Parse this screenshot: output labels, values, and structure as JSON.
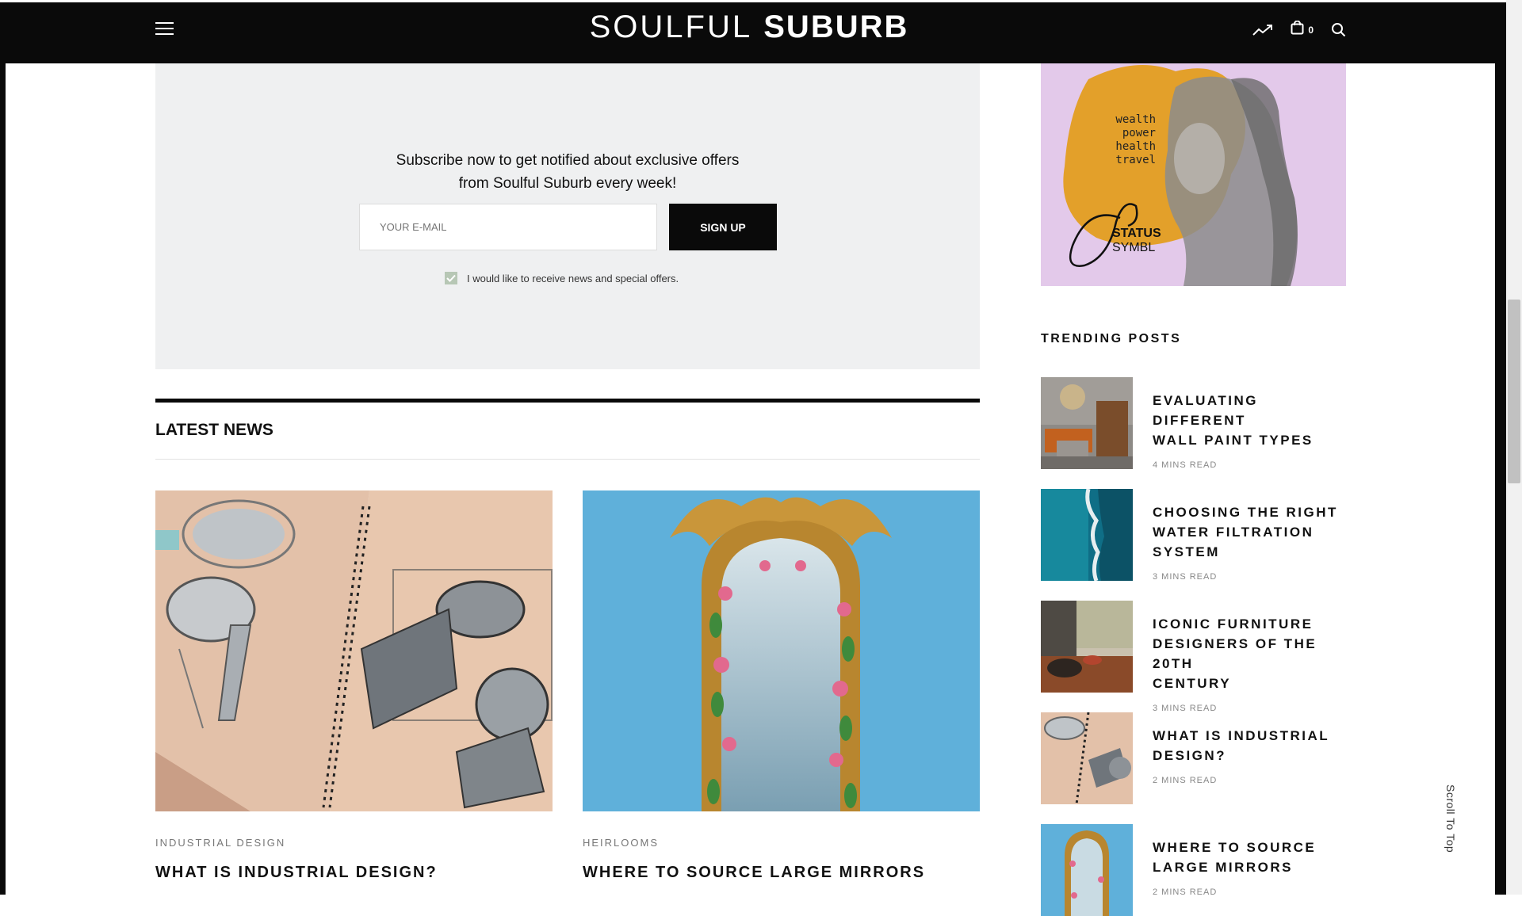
{
  "header": {
    "logo_light": "SOULFUL",
    "logo_bold": "SUBURB",
    "cart_count": "0",
    "icons": [
      "menu-icon",
      "trending-icon",
      "cart-icon",
      "search-icon"
    ]
  },
  "newsletter": {
    "line1": "Subscribe now to get notified about exclusive offers",
    "line2": "from Soulful Suburb every week!",
    "email_placeholder": "YOUR E-MAIL",
    "signup_label": "SIGN UP",
    "consent_label": "I would like to receive news and special offers.",
    "consent_checked": true
  },
  "latest_news": {
    "title": "LATEST NEWS",
    "cards": [
      {
        "category": "INDUSTRIAL DESIGN",
        "title": "WHAT IS INDUSTRIAL DESIGN?"
      },
      {
        "category": "HEIRLOOMS",
        "title": "WHERE TO SOURCE LARGE MIRRORS"
      }
    ]
  },
  "sidebar": {
    "ad": {
      "words": [
        "wealth",
        "power",
        "health",
        "travel"
      ],
      "brand_line1": "STATUS",
      "brand_line2": "SYMBL"
    },
    "trending_title": "TRENDING POSTS",
    "trending": [
      {
        "line1": "EVALUATING DIFFERENT",
        "line2": "WALL PAINT TYPES",
        "line3": "",
        "read": "4 MINS READ"
      },
      {
        "line1": "CHOOSING THE RIGHT",
        "line2": "WATER FILTRATION",
        "line3": "SYSTEM",
        "read": "3 MINS READ"
      },
      {
        "line1": "ICONIC FURNITURE",
        "line2": "DESIGNERS OF THE 20TH",
        "line3": "CENTURY",
        "read": "3 MINS READ"
      },
      {
        "line1": "WHAT IS INDUSTRIAL",
        "line2": "DESIGN?",
        "line3": "",
        "read": "2 MINS READ"
      },
      {
        "line1": "WHERE TO SOURCE",
        "line2": "LARGE MIRRORS",
        "line3": "",
        "read": "2 MINS READ"
      }
    ]
  },
  "scroll_to_top": "Scroll To Top",
  "colors": {
    "topbar": "#0a0a0a",
    "newsletter_bg": "#eff0f1",
    "checkbox": "#b7c7b5",
    "ad_bg": "#e3c9ea",
    "ad_blob": "#e3a02a",
    "mirror_bg": "#5fb0da"
  }
}
